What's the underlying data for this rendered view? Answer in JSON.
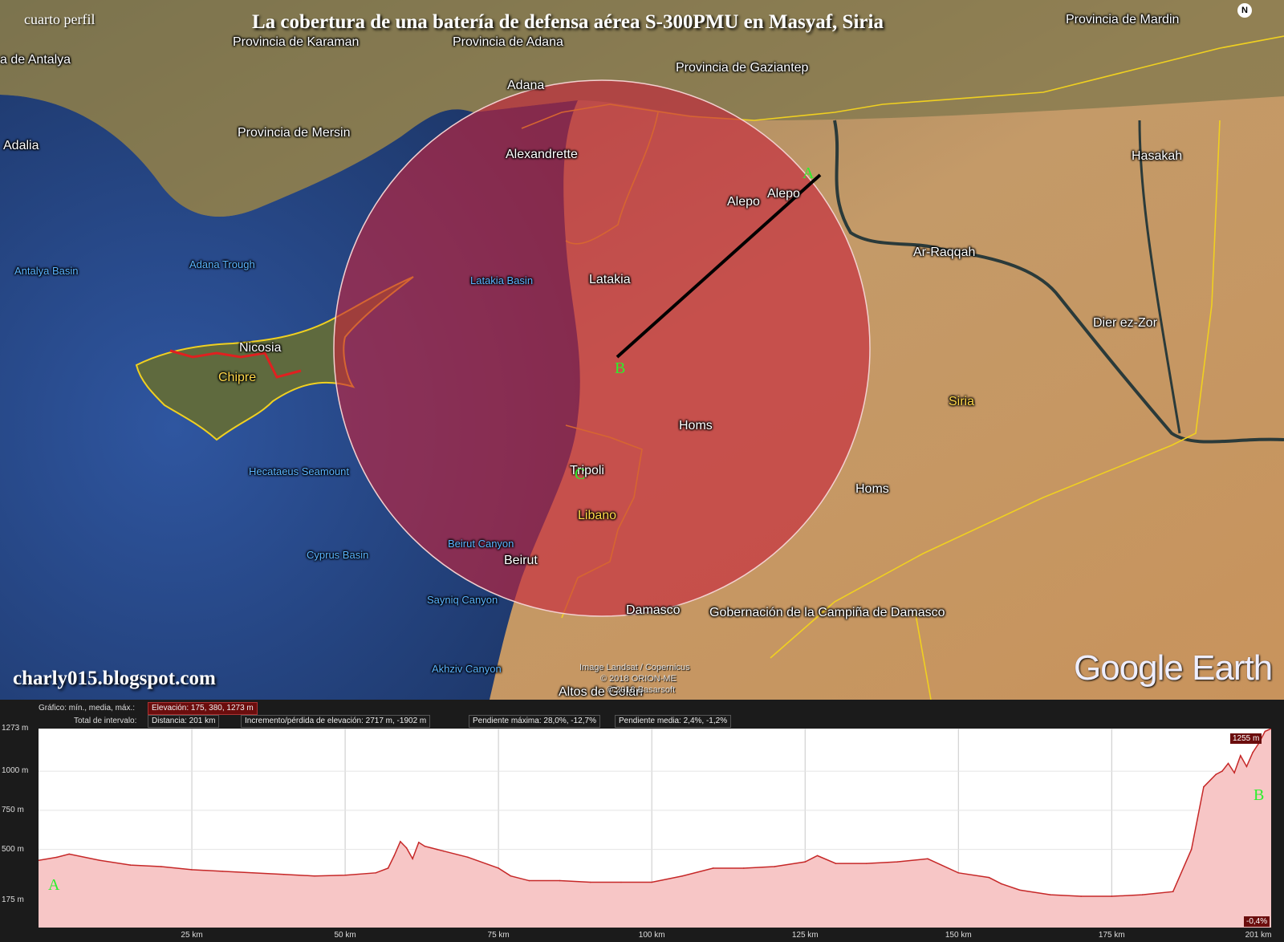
{
  "header": {
    "corner_note": "cuarto perfil",
    "title": "La cobertura de una batería de defensa aérea S-300PMU en Masyaf, Siria"
  },
  "watermark": {
    "blog": "charly015.blogspot.com",
    "brand": "Google Earth",
    "credit_lines": [
      "Image Landsat / Copernicus",
      "© 2018 ORION-ME",
      "© 2018 Basarsoft"
    ]
  },
  "compass": {
    "letter": "N",
    "icon": "north-compass-icon"
  },
  "map": {
    "colors": {
      "sea": "#2a4a86",
      "land": "#b78a5a",
      "coverage": "#c6243c",
      "border": "#f0d020",
      "line": "#000000",
      "point": "#2cf02c"
    },
    "labels": [
      {
        "key": "karaman",
        "text": "Provincia de Karaman",
        "kind": "region"
      },
      {
        "key": "adana_prov",
        "text": "Provincia de Adana",
        "kind": "region"
      },
      {
        "key": "gaziantep",
        "text": "Provincia de Gaziantep",
        "kind": "region"
      },
      {
        "key": "mardin",
        "text": "Provincia de Mardin",
        "kind": "region"
      },
      {
        "key": "antalya",
        "text": "a de Antalya",
        "kind": "region"
      },
      {
        "key": "adana",
        "text": "Adana",
        "kind": "city"
      },
      {
        "key": "mersin",
        "text": "Provincia de Mersin",
        "kind": "region"
      },
      {
        "key": "adalia",
        "text": "Adalia",
        "kind": "city"
      },
      {
        "key": "alexandrette",
        "text": "Alexandrette",
        "kind": "city"
      },
      {
        "key": "alepo1",
        "text": "Alepo",
        "kind": "city"
      },
      {
        "key": "alepo2",
        "text": "Alepo",
        "kind": "city"
      },
      {
        "key": "hasakah",
        "text": "Hasakah",
        "kind": "city"
      },
      {
        "key": "raqqah",
        "text": "Ar-Raqqah",
        "kind": "city"
      },
      {
        "key": "antalya_basin",
        "text": "Antalya Basin",
        "kind": "water"
      },
      {
        "key": "adana_trough",
        "text": "Adana Trough",
        "kind": "water"
      },
      {
        "key": "latakia_basin",
        "text": "Latakia Basin",
        "kind": "water"
      },
      {
        "key": "latakia",
        "text": "Latakia",
        "kind": "city"
      },
      {
        "key": "dier",
        "text": "Dier ez-Zor",
        "kind": "city"
      },
      {
        "key": "nicosia",
        "text": "Nicosia",
        "kind": "city"
      },
      {
        "key": "chipre",
        "text": "Chipre",
        "kind": "country"
      },
      {
        "key": "siria",
        "text": "Siria",
        "kind": "country"
      },
      {
        "key": "homs1",
        "text": "Homs",
        "kind": "city"
      },
      {
        "key": "homs2",
        "text": "Homs",
        "kind": "city"
      },
      {
        "key": "hecataeus",
        "text": "Hecataeus Seamount",
        "kind": "water"
      },
      {
        "key": "tripoli",
        "text": "Tripoli",
        "kind": "city"
      },
      {
        "key": "libano",
        "text": "Libano",
        "kind": "country"
      },
      {
        "key": "beirut_canyon",
        "text": "Beirut Canyon",
        "kind": "water"
      },
      {
        "key": "beirut",
        "text": "Beirut",
        "kind": "city"
      },
      {
        "key": "cyprus_basin",
        "text": "Cyprus Basin",
        "kind": "water"
      },
      {
        "key": "sayniq",
        "text": "Sayniq Canyon",
        "kind": "water"
      },
      {
        "key": "damasco",
        "text": "Damasco",
        "kind": "city"
      },
      {
        "key": "campina",
        "text": "Gobernación de la Campiña de Damasco",
        "kind": "region"
      },
      {
        "key": "akhziv",
        "text": "Akhziv Canyon",
        "kind": "water"
      },
      {
        "key": "altos",
        "text": "Altos de Golán",
        "kind": "region"
      }
    ],
    "points": {
      "a": "A",
      "b": "B",
      "c": "C"
    }
  },
  "profile": {
    "stats_row1_label": "Gráfico: mín., media, máx.:",
    "elevation": "Elevación: 175, 380, 1273 m",
    "stats_row2_label": "Total de intervalo:",
    "distance": "Distancia: 201 km",
    "gain_loss": "Incremento/pérdida de elevación: 2717 m, -1902 m",
    "max_slope": "Pendiente máxima: 28,0%, -12,7%",
    "avg_slope": "Pendiente media: 2,4%, -1,2%",
    "cursor_elevation": "1255 m",
    "cursor_slope": "-0,4%",
    "start_label": "A",
    "end_label": "B"
  },
  "chart_data": {
    "type": "area",
    "title": "",
    "xlabel": "",
    "ylabel": "",
    "x_ticks": [
      "25 km",
      "50 km",
      "75 km",
      "100 km",
      "125 km",
      "150 km",
      "175 km",
      "201 km"
    ],
    "y_ticks": [
      "1273 m",
      "1000 m",
      "750 m",
      "500 m",
      "175 m"
    ],
    "xlim": [
      0,
      201
    ],
    "ylim": [
      0,
      1273
    ],
    "x": [
      0,
      3,
      5,
      10,
      15,
      20,
      25,
      30,
      40,
      45,
      50,
      55,
      57,
      58,
      59,
      60,
      61,
      62,
      63,
      64,
      65,
      66,
      70,
      75,
      77,
      80,
      85,
      90,
      95,
      100,
      105,
      110,
      115,
      120,
      125,
      127,
      130,
      135,
      140,
      145,
      150,
      155,
      157,
      160,
      165,
      170,
      175,
      180,
      185,
      188,
      190,
      192,
      193,
      194,
      195,
      196,
      197,
      198,
      199,
      200,
      201
    ],
    "y": [
      430,
      450,
      470,
      430,
      400,
      390,
      370,
      360,
      340,
      330,
      335,
      350,
      380,
      460,
      550,
      510,
      440,
      545,
      520,
      510,
      500,
      490,
      450,
      380,
      330,
      300,
      300,
      290,
      290,
      290,
      330,
      380,
      380,
      390,
      420,
      460,
      410,
      410,
      420,
      440,
      350,
      320,
      280,
      240,
      210,
      200,
      200,
      210,
      230,
      500,
      900,
      980,
      1000,
      1050,
      990,
      1100,
      1030,
      1120,
      1180,
      1255,
      1273
    ],
    "series": [
      {
        "values_ref": "y",
        "color": "#c62828"
      }
    ],
    "grid": true,
    "legend": "none"
  }
}
